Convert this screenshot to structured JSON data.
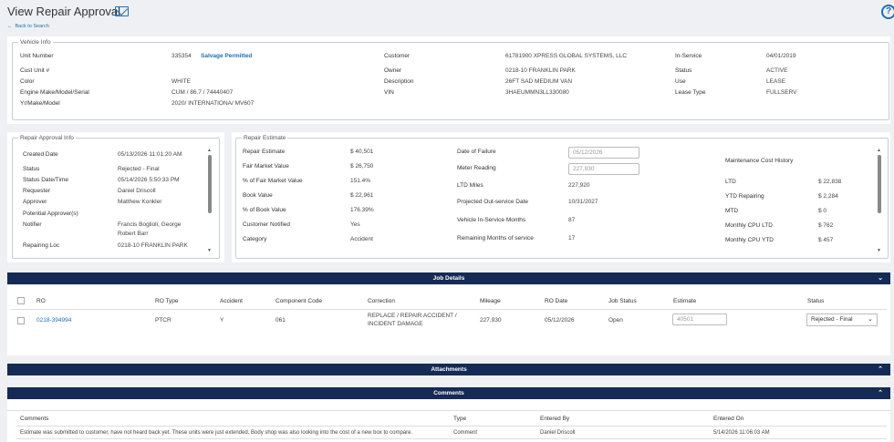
{
  "header": {
    "title": "View Repair Approval",
    "back": "Back to Search",
    "help": "?"
  },
  "vehicle": {
    "legend": "Vehicle Info",
    "unit_number_label": "Unit Number",
    "unit_number": "335354",
    "salvage": "Salvage Permitted",
    "cust_unit_label": "Cust Unit #",
    "color_label": "Color",
    "color": "WHITE",
    "engine_label": "Engine Make/Model/Serial",
    "engine": "CUM / 86.7 / 74440407",
    "yr_label": "Yr/Make/Model",
    "yr": "2020/ INTERNATIONA/ MV607",
    "customer_label": "Customer",
    "customer": "61781900 XPRESS GLOBAL SYSTEMS, LLC",
    "owner_label": "Owner",
    "owner": "0218-10 FRANKLIN PARK",
    "description_label": "Description",
    "description": "26FT SAD MEDIUM VAN",
    "vin_label": "VIN",
    "vin": "3HAEUMMN3LL330080",
    "inservice_label": "In-Service",
    "inservice": "04/01/2019",
    "status_label": "Status",
    "status": "ACTIVE",
    "use_label": "Use",
    "use": "LEASE",
    "lease_label": "Lease Type",
    "lease": "FULLSERV"
  },
  "approval": {
    "legend": "Repair Approval Info",
    "created_label": "Created Date",
    "created": "05/13/2026 11:01:20 AM",
    "status_label": "Status",
    "status": "Rejected - Final",
    "statusdt_label": "Status Date/Time",
    "statusdt": "05/14/2026 5:50:33 PM",
    "requester_label": "Requester",
    "requester": "Daniel Driscoll",
    "approver_label": "Approver",
    "approver": "Matthew Konkler",
    "potential_label": "Potential Approver(s)",
    "notifier_label": "Notifier",
    "notifier1": "Francis Boglioli, George",
    "notifier2": "Robert Barr",
    "loc_label": "Repairing Loc",
    "loc": "0218-10 FRANKLIN PARK"
  },
  "estimate": {
    "legend": "Repair Estimate",
    "repair_label": "Repair Estimate",
    "repair": "$ 40,501",
    "fmv_label": "Fair Market Value",
    "fmv": "$ 26,750",
    "pfmv_label": "% of Fair Market Value",
    "pfmv": "151.4%",
    "book_label": "Book Value",
    "book": "$ 22,961",
    "pbook_label": "% of Book Value",
    "pbook": "176.39%",
    "notified_label": "Customer Notified",
    "notified": "Yes",
    "category_label": "Category",
    "category": "Accident",
    "failure_label": "Date of Failure",
    "failure": "05/12/2026",
    "meter_label": "Meter Reading",
    "meter": "227,930",
    "ltd_miles_label": "LTD Miles",
    "ltd_miles": "227,920",
    "outservice_label": "Projected Out-service Date",
    "outservice": "10/31/2027",
    "months_label": "Vehicle In-Service Months",
    "months": "87",
    "remaining_label": "Remaining Months of service",
    "remaining": "17",
    "history_label": "Maintenance Cost History",
    "ltd_label": "LTD",
    "ltd": "$ 22,838",
    "ytd_label": "YTD Repairing",
    "ytd": "$ 2,284",
    "mtd_label": "MTD",
    "mtd": "$ 0",
    "cpu_ltd_label": "Monthly CPU LTD",
    "cpu_ltd": "$ 762",
    "cpu_ytd_label": "Monthly CPU YTD",
    "cpu_ytd": "$ 457"
  },
  "jobs": {
    "title": "Job Details",
    "columns": [
      "RO",
      "RO Type",
      "Accident",
      "Component Code",
      "Correction",
      "Mileage",
      "RO Date",
      "Job Status",
      "Estimate",
      "Status"
    ],
    "row": {
      "ro": "0218-394994",
      "type": "PTCR",
      "accident": "Y",
      "code": "061",
      "correction1": "REPLACE / REPAIR ACCIDENT /",
      "correction2": "INCIDENT DAMAGE",
      "mileage": "227,930",
      "date": "05/12/2026",
      "job_status": "Open",
      "estimate": "40501",
      "status": "Rejected - Final"
    }
  },
  "attachments": {
    "title": "Attachments"
  },
  "comments": {
    "title": "Comments",
    "columns": [
      "Comments",
      "Type",
      "Entered By",
      "Entered On"
    ],
    "row": {
      "text": "Estimate was submitted to customer, have not heard back yet. These units were just extended. Body shop was also looking into the cost of a new box to compare.",
      "type": "Comment",
      "by": "Daniel Driscoll",
      "on": "5/14/2026 11:06:03 AM"
    }
  },
  "colors": {
    "nav": "#152a55",
    "link": "#1f6fb5"
  }
}
